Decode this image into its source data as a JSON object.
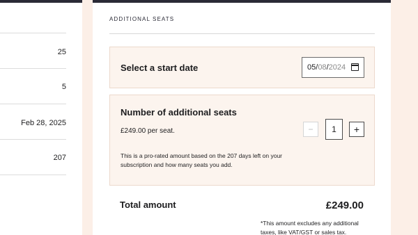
{
  "left_panel": {
    "rows": [
      {
        "value": ""
      },
      {
        "value": "25"
      },
      {
        "value": "5"
      },
      {
        "value": "Feb 28, 2025"
      },
      {
        "value": "207"
      }
    ]
  },
  "card": {
    "section_label": "ADDITIONAL SEATS",
    "start_date": {
      "title": "Select a start date",
      "day": "05",
      "month": "08",
      "year": "2024",
      "sep": "/"
    },
    "seats": {
      "title": "Number of additional seats",
      "price": "£249.00",
      "price_suffix": " per seat.",
      "note": "This is a pro-rated amount based on the 207 days left on your subscription and how many seats you add.",
      "minus": "−",
      "quantity": "1",
      "plus": "+"
    },
    "total": {
      "label": "Total amount",
      "value": "£249.00",
      "tax_note": "*This amount excludes any additional taxes, like VAT/GST or sales tax."
    }
  }
}
